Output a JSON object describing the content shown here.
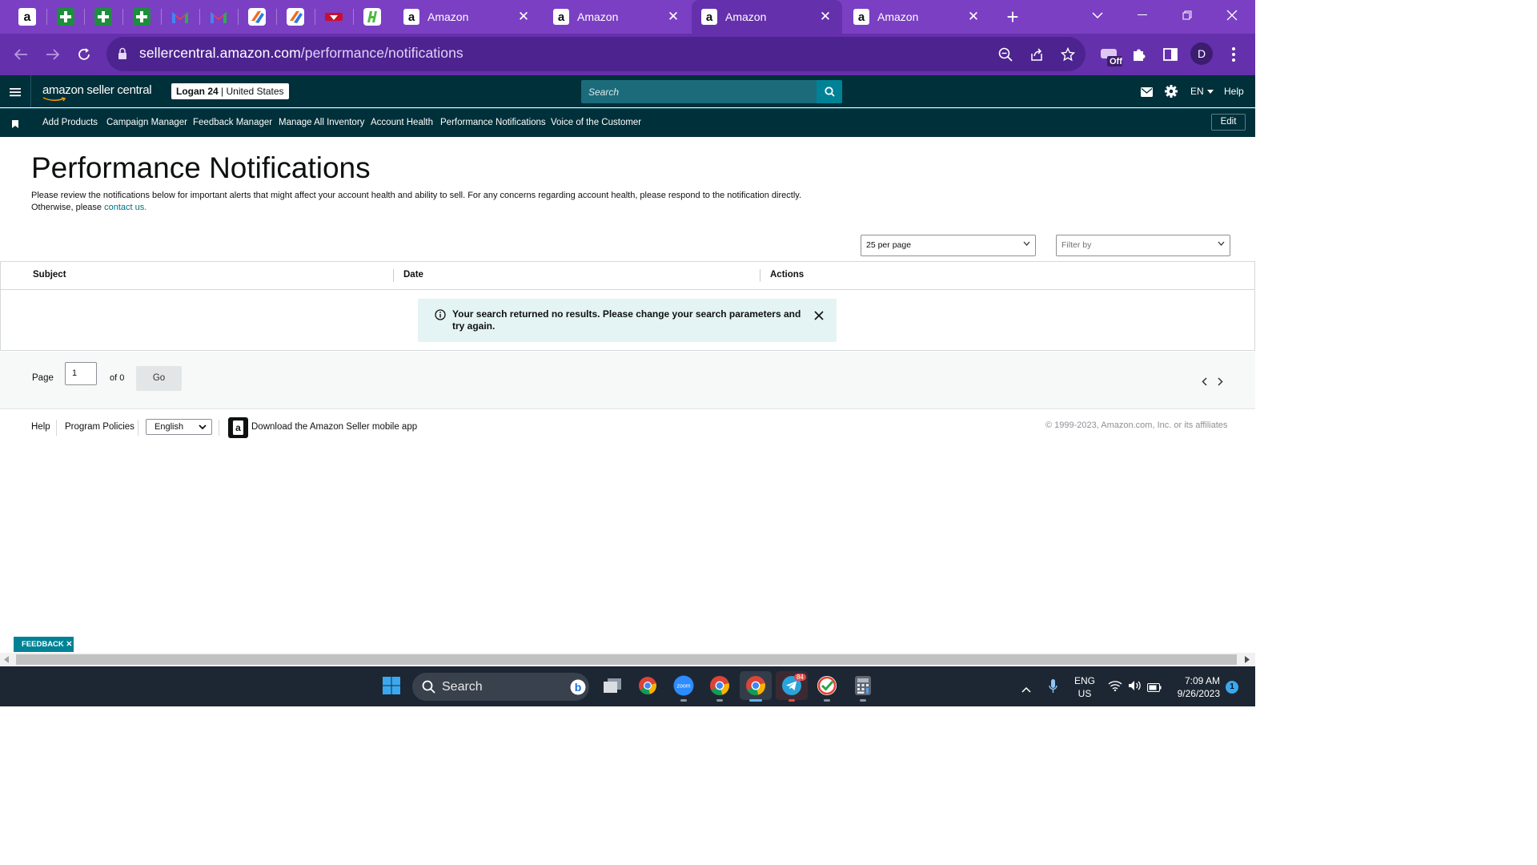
{
  "browser": {
    "tabs": [
      {
        "title": "Amazon"
      },
      {
        "title": "Amazon"
      },
      {
        "title": "Amazon"
      },
      {
        "title": "Amazon"
      }
    ],
    "url_host": "sellercentral.amazon.com",
    "url_path": "/performance/notifications",
    "extension_badge": "Off",
    "profile_initial": "D"
  },
  "header": {
    "logo": "amazon seller central",
    "store_name": "Logan 24",
    "store_region": "| United States",
    "search_placeholder": "Search",
    "language": "EN",
    "help": "Help"
  },
  "nav": {
    "items": [
      "Add Products",
      "Campaign Manager",
      "Feedback Manager",
      "Manage All Inventory",
      "Account Health",
      "Performance Notifications",
      "Voice of the Customer"
    ],
    "edit": "Edit"
  },
  "page": {
    "title": "Performance Notifications",
    "description": "Please review the notifications below for important alerts that might affect your account health and ability to sell. For any concerns regarding account health, please respond to the notification directly. Otherwise, please",
    "contact_link": "contact us.",
    "per_page": "25 per page",
    "filter_placeholder": "Filter by"
  },
  "table": {
    "columns": [
      "Subject",
      "Date",
      "Actions"
    ],
    "empty_message": "Your search returned no results. Please change your search parameters and try again."
  },
  "pager": {
    "label": "Page",
    "current": "1",
    "of_label": "of 0",
    "go": "Go"
  },
  "footer": {
    "help": "Help",
    "policies": "Program Policies",
    "language": "English",
    "app_link": "Download the Amazon Seller mobile app",
    "copyright": "© 1999-2023, Amazon.com, Inc. or its affiliates"
  },
  "feedback": "FEEDBACK",
  "taskbar": {
    "search": "Search",
    "telegram_badge": "84",
    "lang_top": "ENG",
    "lang_bottom": "US",
    "time": "7:09 AM",
    "date": "9/26/2023",
    "notification_count": "1"
  },
  "colors": {
    "chrome_frame": "#7b3fc4",
    "chrome_toolbar": "#6530ac",
    "amazon_header": "#00303a",
    "link": "#007185",
    "alert_bg": "#e4f3f3"
  }
}
